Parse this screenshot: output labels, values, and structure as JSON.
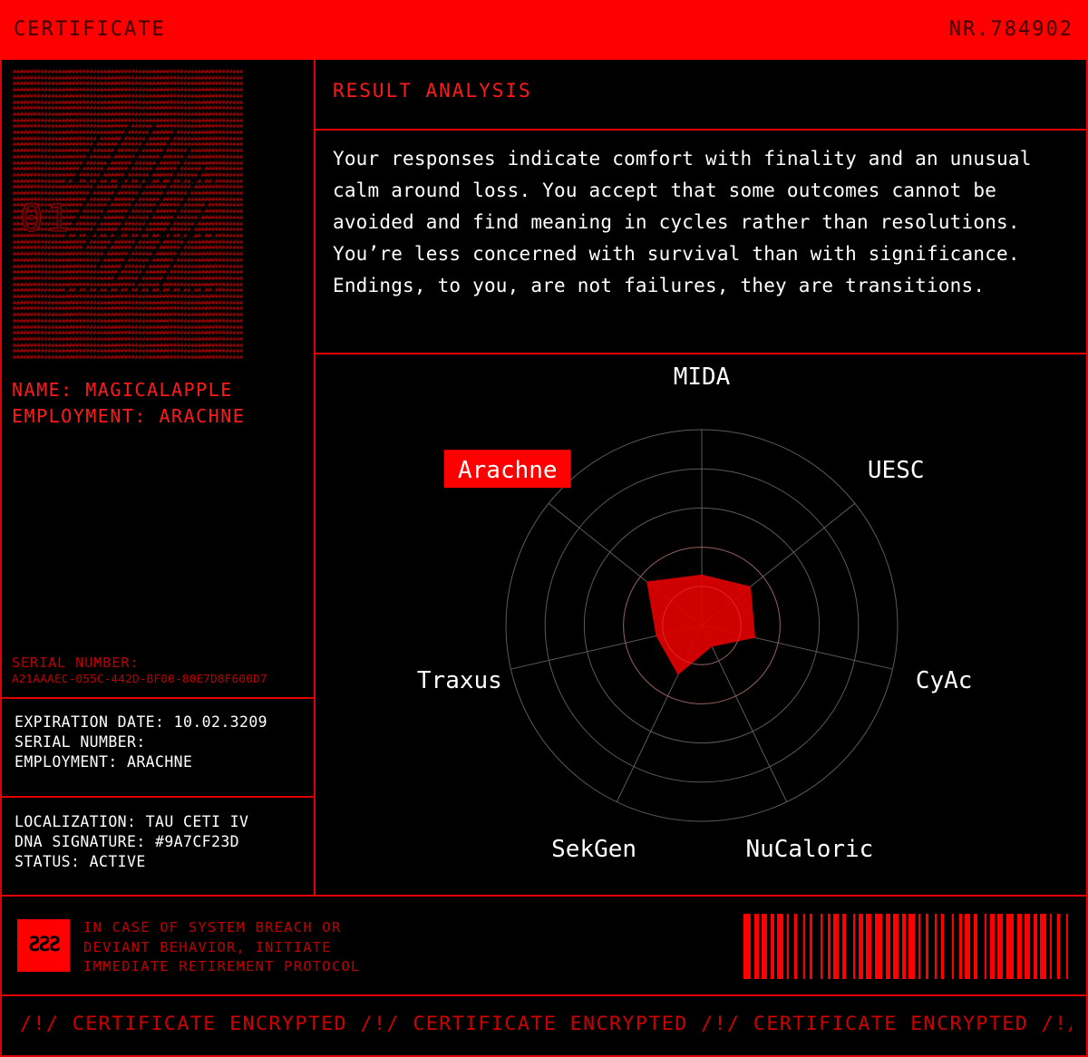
{
  "header": {
    "title": "CERTIFICATE",
    "number": "NR.784902"
  },
  "profile": {
    "name_line": "NAME: MAGICALAPPLE",
    "employment_line": "EMPLOYMENT: ARACHNE",
    "serial_label": "SERIAL NUMBER:",
    "serial_value": "A21AAAEC-055C-442D-BF00-80E7D8F600D7"
  },
  "details": {
    "expiration": "EXPIRATION DATE: 10.02.3209",
    "serial": "SERIAL NUMBER:",
    "employment": "EMPLOYMENT: ARACHNE"
  },
  "location": {
    "localization": "LOCALIZATION: TAU CETI IV",
    "dna": "DNA SIGNATURE: #9A7CF23D",
    "status": "STATUS: ACTIVE"
  },
  "analysis": {
    "title": "RESULT ANALYSIS",
    "text": "Your responses indicate comfort with finality and an unusual calm around loss. You accept that some outcomes cannot be avoided and find meaning in cycles rather than resolutions. You’re less concerned with survival than with significance. Endings, to you, are not failures, they are transitions."
  },
  "chart_data": {
    "type": "radar",
    "axes": [
      "MIDA",
      "UESC",
      "CyAc",
      "NuCaloric",
      "SekGen",
      "Traxus",
      "Arachne"
    ],
    "highlighted_axis": "Arachne",
    "rings": 5,
    "range": [
      0,
      5
    ],
    "values": [
      1.3,
      1.6,
      1.4,
      0.6,
      1.4,
      1.2,
      1.8
    ],
    "fill_color": "#e00000"
  },
  "footer": {
    "warning": [
      "IN CASE OF SYSTEM BREACH OR",
      "DEVIANT BEHAVIOR, INITIATE",
      "IMMEDIATE RETIREMENT PROTOCOL"
    ],
    "icon": "warning-glyph-icon",
    "marquee": "/!/ CERTIFICATE ENCRYPTED /!/ CERTIFICATE ENCRYPTED /!/ CERTIFICATE ENCRYPTED /!/ CE"
  },
  "colors": {
    "accent": "#ff0000",
    "background": "#000000",
    "text": "#ffffff"
  }
}
